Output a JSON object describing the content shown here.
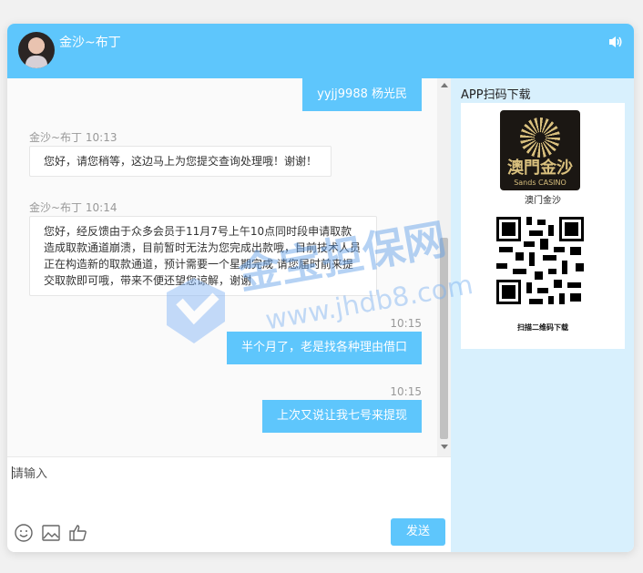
{
  "header": {
    "title": "金沙~布丁",
    "speaker_icon": "speaker-icon",
    "bg_color": "#5ec6fc"
  },
  "chat": {
    "messages": [
      {
        "side": "right",
        "time": "",
        "text": "yyjj9988 杨光民"
      },
      {
        "side": "left",
        "sender": "金沙~布丁",
        "time": "10:13",
        "text": "您好，请您稍等，这边马上为您提交查询处理哦！谢谢！"
      },
      {
        "side": "left",
        "sender": "金沙~布丁",
        "time": "10:14",
        "text": "您好，经反馈由于众多会员于11月7号上午10点同时段申请取款造成取款通道崩溃，目前暂时无法为您完成出款哦，目前技术人员正在构造新的取款通道，预计需要一个星期完成 请您届时前来提交取款即可哦，带来不便还望您谅解，谢谢"
      },
      {
        "side": "right",
        "time": "10:15",
        "text": "半个月了，老是找各种理由借口"
      },
      {
        "side": "right",
        "time": "10:15",
        "text": "上次又说让我七号来提现"
      }
    ]
  },
  "input": {
    "placeholder": "请输入",
    "value": ""
  },
  "toolbar": {
    "emoji_icon": "smile-icon",
    "image_icon": "image-icon",
    "like_icon": "thumbs-up-icon",
    "send_label": "发送"
  },
  "sidebar": {
    "title": "APP扫码下载",
    "logo_text": "澳門金沙",
    "logo_sub": "Sands CASINO",
    "logo_caption": "澳门金沙",
    "qr_caption": "扫描二维码下载",
    "bg_color": "#d8f0fd"
  },
  "watermark": {
    "brand": "金宝担保网",
    "url": "www.jhdb8.com"
  }
}
